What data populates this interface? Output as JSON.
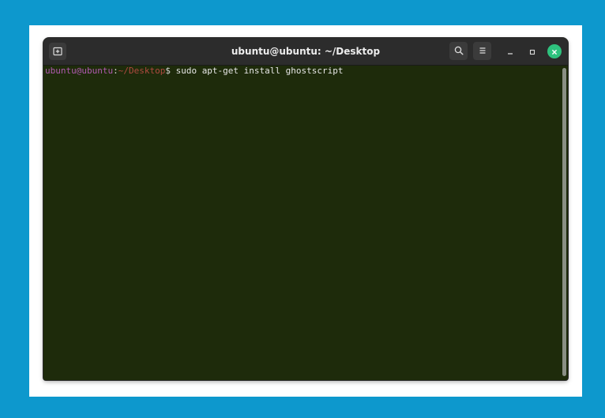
{
  "window": {
    "title": "ubuntu@ubuntu: ~/Desktop"
  },
  "icons": {
    "new_tab": "new-tab-icon",
    "search": "search-icon",
    "menu": "hamburger-menu-icon",
    "minimize": "minimize-icon",
    "maximize": "maximize-icon",
    "close": "close-icon"
  },
  "terminal": {
    "prompt_user": "ubuntu@ubuntu",
    "prompt_colon": ":",
    "prompt_path": "~/Desktop",
    "prompt_symbol": "$",
    "command": " sudo apt-get install ghostscript"
  },
  "colors": {
    "desktop_background": "#0d98cd",
    "terminal_background": "#1e2b0b",
    "titlebar": "#2c2c2c",
    "close_button": "#2ec27e"
  }
}
